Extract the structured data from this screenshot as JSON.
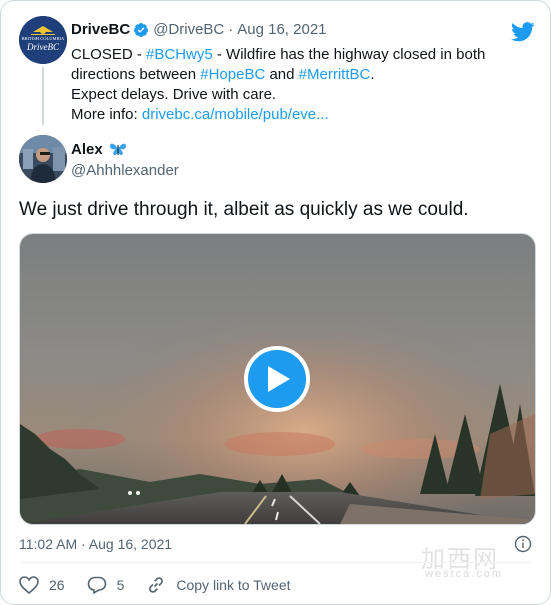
{
  "quoted_tweet": {
    "display_name": "DriveBC",
    "handle": "@DriveBC",
    "separator": "·",
    "date": "Aug 16, 2021",
    "avatar_text_top": "BRITISH COLUMBIA",
    "avatar_text_bottom": "DriveBC",
    "line1_prefix": "CLOSED - ",
    "line1_hashtag": "#BCHwy5",
    "line1_suffix": " - Wildfire has the highway closed in both directions between ",
    "line1_hashtag2": "#HopeBC",
    "line1_and": " and ",
    "line1_hashtag3": "#MerrittBC",
    "line1_end": ".",
    "line2": "Expect delays. Drive with care.",
    "line3_prefix": "More info: ",
    "line3_link": "drivebc.ca/mobile/pub/eve..."
  },
  "tweet": {
    "display_name": "Alex",
    "handle": "@Ahhhlexander",
    "text": "We just drive through it, albeit as quickly as we could.",
    "timestamp": "11:02 AM · Aug 16, 2021"
  },
  "actions": {
    "like_count": "26",
    "reply_count": "5",
    "copy_link_label": "Copy link to Tweet"
  },
  "watermark": {
    "main": "加西网",
    "sub": "westca.com"
  },
  "colors": {
    "accent": "#1d9bf0",
    "muted": "#536471",
    "text": "#0f1419"
  },
  "icons": [
    "twitter-bird-icon",
    "verified-badge-icon",
    "butterfly-emoji-icon",
    "play-icon",
    "info-icon",
    "heart-icon",
    "reply-icon",
    "link-icon"
  ]
}
